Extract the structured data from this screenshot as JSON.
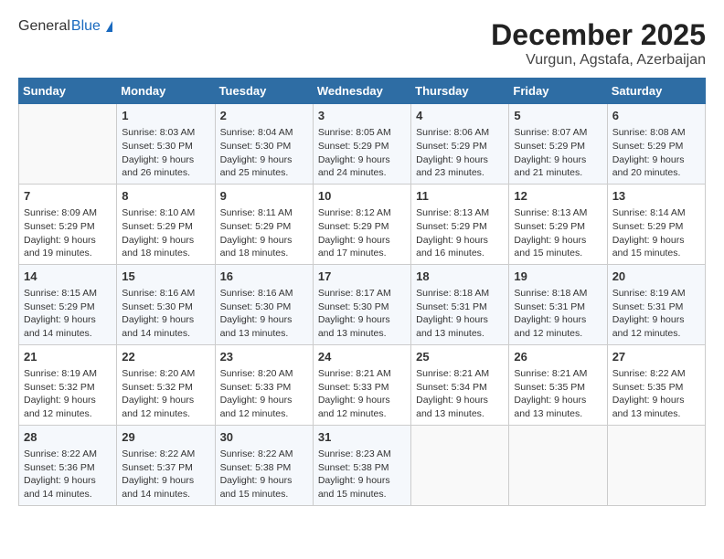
{
  "header": {
    "logo_general": "General",
    "logo_blue": "Blue",
    "month": "December 2025",
    "location": "Vurgun, Agstafa, Azerbaijan"
  },
  "weekdays": [
    "Sunday",
    "Monday",
    "Tuesday",
    "Wednesday",
    "Thursday",
    "Friday",
    "Saturday"
  ],
  "weeks": [
    [
      {
        "day": "",
        "info": ""
      },
      {
        "day": "1",
        "info": "Sunrise: 8:03 AM\nSunset: 5:30 PM\nDaylight: 9 hours\nand 26 minutes."
      },
      {
        "day": "2",
        "info": "Sunrise: 8:04 AM\nSunset: 5:30 PM\nDaylight: 9 hours\nand 25 minutes."
      },
      {
        "day": "3",
        "info": "Sunrise: 8:05 AM\nSunset: 5:29 PM\nDaylight: 9 hours\nand 24 minutes."
      },
      {
        "day": "4",
        "info": "Sunrise: 8:06 AM\nSunset: 5:29 PM\nDaylight: 9 hours\nand 23 minutes."
      },
      {
        "day": "5",
        "info": "Sunrise: 8:07 AM\nSunset: 5:29 PM\nDaylight: 9 hours\nand 21 minutes."
      },
      {
        "day": "6",
        "info": "Sunrise: 8:08 AM\nSunset: 5:29 PM\nDaylight: 9 hours\nand 20 minutes."
      }
    ],
    [
      {
        "day": "7",
        "info": "Sunrise: 8:09 AM\nSunset: 5:29 PM\nDaylight: 9 hours\nand 19 minutes."
      },
      {
        "day": "8",
        "info": "Sunrise: 8:10 AM\nSunset: 5:29 PM\nDaylight: 9 hours\nand 18 minutes."
      },
      {
        "day": "9",
        "info": "Sunrise: 8:11 AM\nSunset: 5:29 PM\nDaylight: 9 hours\nand 18 minutes."
      },
      {
        "day": "10",
        "info": "Sunrise: 8:12 AM\nSunset: 5:29 PM\nDaylight: 9 hours\nand 17 minutes."
      },
      {
        "day": "11",
        "info": "Sunrise: 8:13 AM\nSunset: 5:29 PM\nDaylight: 9 hours\nand 16 minutes."
      },
      {
        "day": "12",
        "info": "Sunrise: 8:13 AM\nSunset: 5:29 PM\nDaylight: 9 hours\nand 15 minutes."
      },
      {
        "day": "13",
        "info": "Sunrise: 8:14 AM\nSunset: 5:29 PM\nDaylight: 9 hours\nand 15 minutes."
      }
    ],
    [
      {
        "day": "14",
        "info": "Sunrise: 8:15 AM\nSunset: 5:29 PM\nDaylight: 9 hours\nand 14 minutes."
      },
      {
        "day": "15",
        "info": "Sunrise: 8:16 AM\nSunset: 5:30 PM\nDaylight: 9 hours\nand 14 minutes."
      },
      {
        "day": "16",
        "info": "Sunrise: 8:16 AM\nSunset: 5:30 PM\nDaylight: 9 hours\nand 13 minutes."
      },
      {
        "day": "17",
        "info": "Sunrise: 8:17 AM\nSunset: 5:30 PM\nDaylight: 9 hours\nand 13 minutes."
      },
      {
        "day": "18",
        "info": "Sunrise: 8:18 AM\nSunset: 5:31 PM\nDaylight: 9 hours\nand 13 minutes."
      },
      {
        "day": "19",
        "info": "Sunrise: 8:18 AM\nSunset: 5:31 PM\nDaylight: 9 hours\nand 12 minutes."
      },
      {
        "day": "20",
        "info": "Sunrise: 8:19 AM\nSunset: 5:31 PM\nDaylight: 9 hours\nand 12 minutes."
      }
    ],
    [
      {
        "day": "21",
        "info": "Sunrise: 8:19 AM\nSunset: 5:32 PM\nDaylight: 9 hours\nand 12 minutes."
      },
      {
        "day": "22",
        "info": "Sunrise: 8:20 AM\nSunset: 5:32 PM\nDaylight: 9 hours\nand 12 minutes."
      },
      {
        "day": "23",
        "info": "Sunrise: 8:20 AM\nSunset: 5:33 PM\nDaylight: 9 hours\nand 12 minutes."
      },
      {
        "day": "24",
        "info": "Sunrise: 8:21 AM\nSunset: 5:33 PM\nDaylight: 9 hours\nand 12 minutes."
      },
      {
        "day": "25",
        "info": "Sunrise: 8:21 AM\nSunset: 5:34 PM\nDaylight: 9 hours\nand 13 minutes."
      },
      {
        "day": "26",
        "info": "Sunrise: 8:21 AM\nSunset: 5:35 PM\nDaylight: 9 hours\nand 13 minutes."
      },
      {
        "day": "27",
        "info": "Sunrise: 8:22 AM\nSunset: 5:35 PM\nDaylight: 9 hours\nand 13 minutes."
      }
    ],
    [
      {
        "day": "28",
        "info": "Sunrise: 8:22 AM\nSunset: 5:36 PM\nDaylight: 9 hours\nand 14 minutes."
      },
      {
        "day": "29",
        "info": "Sunrise: 8:22 AM\nSunset: 5:37 PM\nDaylight: 9 hours\nand 14 minutes."
      },
      {
        "day": "30",
        "info": "Sunrise: 8:22 AM\nSunset: 5:38 PM\nDaylight: 9 hours\nand 15 minutes."
      },
      {
        "day": "31",
        "info": "Sunrise: 8:23 AM\nSunset: 5:38 PM\nDaylight: 9 hours\nand 15 minutes."
      },
      {
        "day": "",
        "info": ""
      },
      {
        "day": "",
        "info": ""
      },
      {
        "day": "",
        "info": ""
      }
    ]
  ]
}
